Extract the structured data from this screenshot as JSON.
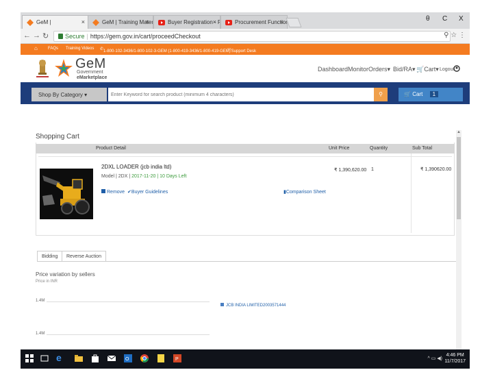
{
  "browser": {
    "tabs": [
      {
        "label": "GeM |",
        "active": true
      },
      {
        "label": "GeM | Training Material",
        "active": false
      },
      {
        "label": "Buyer Registration - F",
        "active": false
      },
      {
        "label": "Procurement Function -",
        "active": false
      }
    ],
    "close_glyph": "×",
    "window_buttons": [
      "θ",
      "C",
      "X"
    ],
    "secure_label": "Secure",
    "url": "https://gem.gov.in/cart/proceedCheckout"
  },
  "topbar": {
    "faqs": "FAQs",
    "training_videos": "Training Videos",
    "helpline": "1-800-102-3436/1-800-102-3-GEM (1-800-419-3436/1-800-419-GEM)",
    "support_desk": "Support Desk",
    "bg_color": "#f47b20"
  },
  "header": {
    "logo_name": "GeM",
    "logo_line1": "Government",
    "logo_line2": "eMarketplace",
    "nav": [
      "Dashboard",
      "Monitor",
      "Orders▾",
      "Bid/RA▾",
      "Cart▾",
      "Logout"
    ]
  },
  "search": {
    "category_label": "Shop By Category ▾",
    "placeholder": "Enter Keyword for search product (minimum 4 characters)",
    "cart_label": "Cart",
    "cart_count": "1"
  },
  "cart": {
    "title": "Shopping Cart",
    "columns": [
      "Product Detail",
      "Unit Price",
      "Quantity",
      "Sub Total"
    ],
    "item": {
      "name": "2DXL LOADER (jcb india ltd)",
      "model_prefix": "Model | 2DX | ",
      "model_highlight": "2017-11-20 | 10 Days Left",
      "remove": "Remove",
      "guidelines": "Buyer Guidelines",
      "comparison": "Comparison Sheet",
      "unit_price": "₹ 1,390,620.00",
      "quantity": "1",
      "sub_total": "₹ 1,390620.00"
    }
  },
  "tabs": [
    "Bidding",
    "Reverse Auction"
  ],
  "price_variation": {
    "title": "Price variation by sellers",
    "subtitle": "Price in INR",
    "ticks": [
      "1.4M",
      "1.4M"
    ],
    "legend": "JCB INDIA LIMITED2003571444"
  },
  "taskbar": {
    "time": "4:46 PM",
    "date": "11/7/2017"
  }
}
